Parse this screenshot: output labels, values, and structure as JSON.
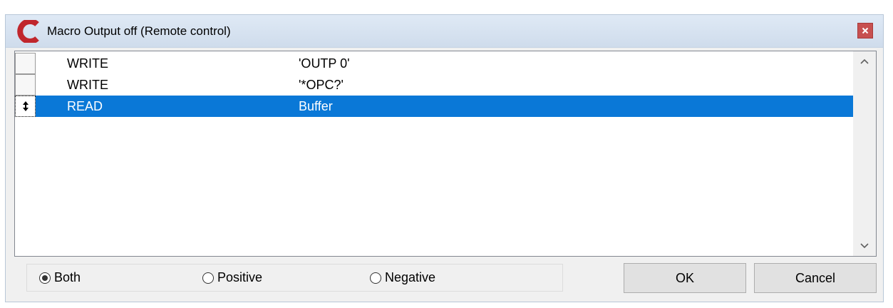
{
  "window": {
    "title": "Macro Output off (Remote control)",
    "close_glyph": "×",
    "accent_color": "#c0262c",
    "close_color": "#c75050"
  },
  "list": {
    "rows": [
      {
        "command": "WRITE",
        "value": "'OUTP 0'",
        "selected": false
      },
      {
        "command": "WRITE",
        "value": "'*OPC?'",
        "selected": false
      },
      {
        "command": "READ",
        "value": "Buffer",
        "selected": true
      }
    ],
    "selected_row_color": "#0a78d7",
    "drag_handle_glyph": "⬍",
    "scroll_up_glyph": "︿",
    "scroll_down_glyph": "﹀"
  },
  "filter": {
    "options": [
      {
        "label": "Both",
        "checked": true
      },
      {
        "label": "Positive",
        "checked": false
      },
      {
        "label": "Negative",
        "checked": false
      }
    ]
  },
  "buttons": {
    "ok_label": "OK",
    "cancel_label": "Cancel"
  }
}
